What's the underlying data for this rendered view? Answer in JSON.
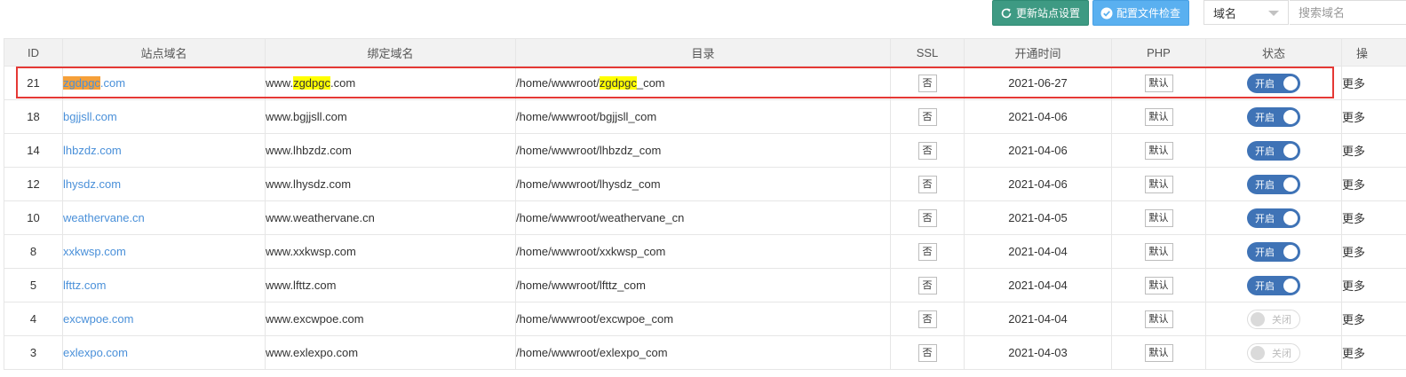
{
  "toolbar": {
    "refresh_label": "更新站点设置",
    "check_label": "配置文件检查",
    "select_value": "域名",
    "search_placeholder": "搜索域名"
  },
  "table": {
    "headers": {
      "id": "ID",
      "site": "站点域名",
      "bind": "绑定域名",
      "dir": "目录",
      "ssl": "SSL",
      "date": "开通时间",
      "php": "PHP",
      "status": "状态",
      "action": "操"
    },
    "highlight_term": "zgdpgc",
    "rows": [
      {
        "id": "21",
        "site": "zgdpgc.com",
        "bind": "www.zgdpgc.com",
        "dir": "/home/wwwroot/zgdpgc_com",
        "ssl": "否",
        "date": "2021-06-27",
        "php": "默认",
        "status": "开启",
        "on": true,
        "more": "更多"
      },
      {
        "id": "18",
        "site": "bgjjsll.com",
        "bind": "www.bgjjsll.com",
        "dir": "/home/wwwroot/bgjjsll_com",
        "ssl": "否",
        "date": "2021-04-06",
        "php": "默认",
        "status": "开启",
        "on": true,
        "more": "更多"
      },
      {
        "id": "14",
        "site": "lhbzdz.com",
        "bind": "www.lhbzdz.com",
        "dir": "/home/wwwroot/lhbzdz_com",
        "ssl": "否",
        "date": "2021-04-06",
        "php": "默认",
        "status": "开启",
        "on": true,
        "more": "更多"
      },
      {
        "id": "12",
        "site": "lhysdz.com",
        "bind": "www.lhysdz.com",
        "dir": "/home/wwwroot/lhysdz_com",
        "ssl": "否",
        "date": "2021-04-06",
        "php": "默认",
        "status": "开启",
        "on": true,
        "more": "更多"
      },
      {
        "id": "10",
        "site": "weathervane.cn",
        "bind": "www.weathervane.cn",
        "dir": "/home/wwwroot/weathervane_cn",
        "ssl": "否",
        "date": "2021-04-05",
        "php": "默认",
        "status": "开启",
        "on": true,
        "more": "更多"
      },
      {
        "id": "8",
        "site": "xxkwsp.com",
        "bind": "www.xxkwsp.com",
        "dir": "/home/wwwroot/xxkwsp_com",
        "ssl": "否",
        "date": "2021-04-04",
        "php": "默认",
        "status": "开启",
        "on": true,
        "more": "更多"
      },
      {
        "id": "5",
        "site": "lfttz.com",
        "bind": "www.lfttz.com",
        "dir": "/home/wwwroot/lfttz_com",
        "ssl": "否",
        "date": "2021-04-04",
        "php": "默认",
        "status": "开启",
        "on": true,
        "more": "更多"
      },
      {
        "id": "4",
        "site": "excwpoe.com",
        "bind": "www.excwpoe.com",
        "dir": "/home/wwwroot/excwpoe_com",
        "ssl": "否",
        "date": "2021-04-04",
        "php": "默认",
        "status": "关闭",
        "on": false,
        "more": "更多"
      },
      {
        "id": "3",
        "site": "exlexpo.com",
        "bind": "www.exlexpo.com",
        "dir": "/home/wwwroot/exlexpo_com",
        "ssl": "否",
        "date": "2021-04-03",
        "php": "默认",
        "status": "关闭",
        "on": false,
        "more": "更多"
      }
    ]
  },
  "colors": {
    "refresh_button": "#3e9a83",
    "check_button": "#5ab0f0",
    "link": "#4a90d9",
    "toggle_on": "#3f73b6",
    "highlight_yellow": "#ffff00",
    "highlight_orange": "#f5a03a",
    "selection_frame": "#e53935"
  }
}
